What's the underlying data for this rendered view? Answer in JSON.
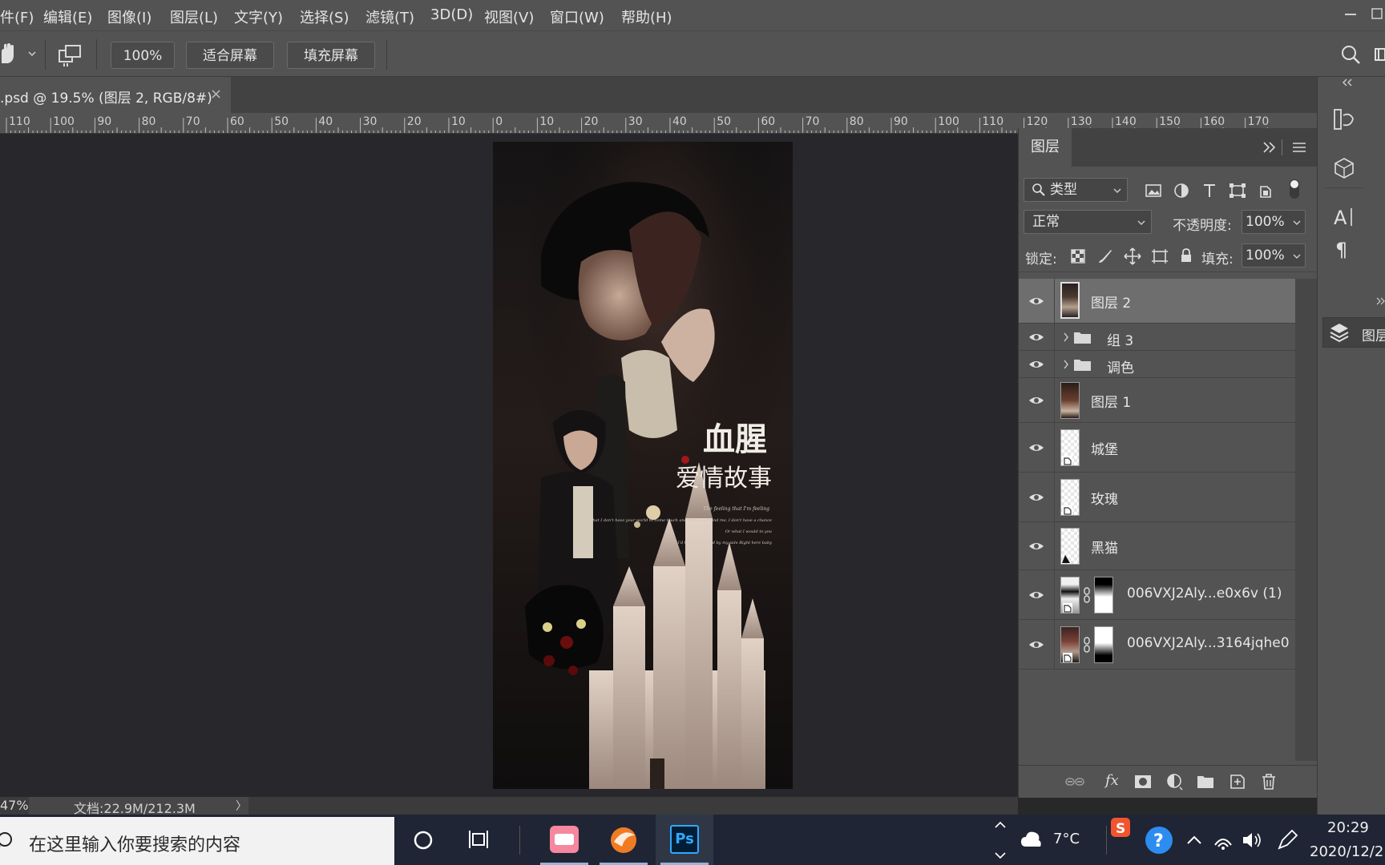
{
  "menu": {
    "items": [
      "件(F)",
      "编辑(E)",
      "图像(I)",
      "图层(L)",
      "文字(Y)",
      "选择(S)",
      "滤镜(T)",
      "3D(D)",
      "视图(V)",
      "窗口(W)",
      "帮助(H)"
    ]
  },
  "options_bar": {
    "zoom_value": "100%",
    "fit_screen_label": "适合屏幕",
    "fill_screen_label": "填充屏幕"
  },
  "document_tab": {
    "title": ".psd @ 19.5% (图层 2, RGB/8#)",
    "close_glyph": "×"
  },
  "ruler": {
    "labels": [
      "110",
      "100",
      "90",
      "80",
      "70",
      "60",
      "50",
      "40",
      "30",
      "20",
      "10",
      "0",
      "10",
      "20",
      "30",
      "40",
      "50",
      "60",
      "70",
      "80",
      "90",
      "100",
      "110",
      "120",
      "130",
      "140",
      "150",
      "160",
      "170"
    ]
  },
  "artwork": {
    "title_line1": "血腥",
    "title_line2": "爱情故事",
    "script_lines": [
      "The feeling that I'm feeling",
      "Now that I don't have your world to come touch and then you'll find me, I don't have a chance",
      "Or what I would to you",
      "I'd have you stand by my side Right here baby"
    ]
  },
  "status_bar": {
    "zoom": "47%",
    "doc_info": "文档:22.9M/212.3M",
    "arrow": "〉"
  },
  "layers_panel": {
    "tab_label": "图层",
    "filter_label": "类型",
    "blend_mode": "正常",
    "opacity_label": "不透明度:",
    "opacity_value": "100%",
    "lock_label": "锁定:",
    "fill_label": "填充:",
    "fill_value": "100%",
    "layers": [
      {
        "name": "图层 2",
        "selected": true,
        "type": "pixel"
      },
      {
        "name": "组 3",
        "selected": false,
        "type": "group"
      },
      {
        "name": "调色",
        "selected": false,
        "type": "group"
      },
      {
        "name": "图层 1",
        "selected": false,
        "type": "pixel"
      },
      {
        "name": "城堡",
        "selected": false,
        "type": "smart"
      },
      {
        "name": "玫瑰",
        "selected": false,
        "type": "smart"
      },
      {
        "name": "黑猫",
        "selected": false,
        "type": "smart"
      },
      {
        "name": "006VXJ2Aly...e0x6v (1)",
        "selected": false,
        "type": "masked"
      },
      {
        "name": "006VXJ2Aly...3164jqhe0",
        "selected": false,
        "type": "masked"
      }
    ],
    "footer_fx": "fx"
  },
  "right_dock": {
    "layers_collapsed_label": "图层"
  },
  "taskbar": {
    "search_placeholder": "在这里输入你要搜索的内容",
    "weather_temp": "7°C",
    "time": "20:29",
    "date": "2020/12/2"
  },
  "colors": {
    "panel_bg": "#535353",
    "selected_layer": "#6e6e6e",
    "ps_icon_bg": "#001e36",
    "ps_icon_text": "#31a8ff"
  }
}
